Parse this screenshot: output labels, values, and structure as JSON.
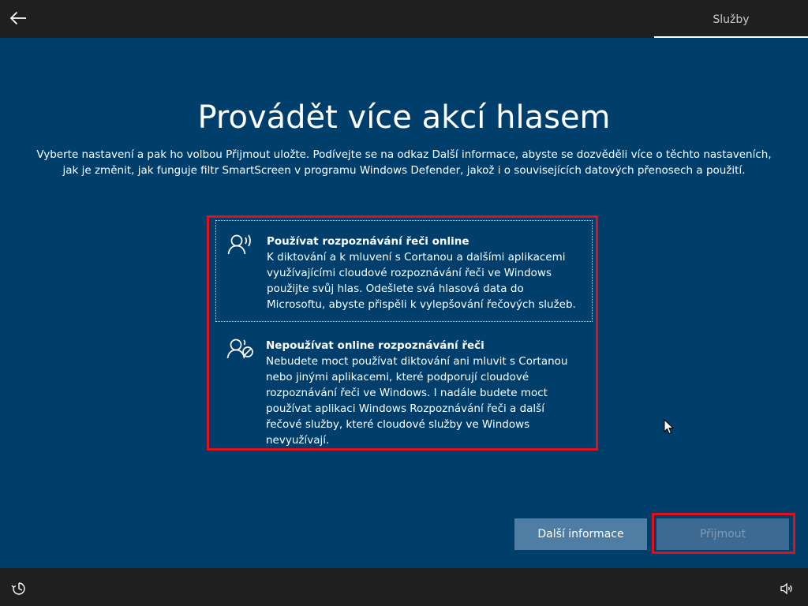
{
  "header": {
    "back_icon": "arrow-left-icon",
    "tab_label": "Služby"
  },
  "main": {
    "title": "Provádět více akcí hlasem",
    "subtitle": "Vyberte nastavení a pak ho volbou Přijmout uložte. Podívejte se na odkaz Další informace, abyste se dozvěděli více o těchto nastaveních, jak je změnit, jak funguje filtr SmartScreen v programu Windows Defender, jakož i o souvisejících datových přenosech a použití.",
    "options": [
      {
        "icon": "speech-person-icon",
        "title": "Používat rozpoznávání řeči online",
        "description": "K diktování a k mluvení s Cortanou a dalšími aplikacemi využívajícími cloudové rozpoznávání řeči ve Windows použijte svůj hlas. Odešlete svá hlasová data do Microsoftu, abyste přispěli k vylepšování řečových služeb."
      },
      {
        "icon": "speech-person-disabled-icon",
        "title": "Nepoužívat online rozpoznávání řeči",
        "description": "Nebudete moct používat diktování ani mluvit s Cortanou nebo jinými aplikacemi, které podporují cloudové rozpoznávání řeči ve Windows. I nadále budete moct používat aplikaci Windows Rozpoznávání řeči a další řečové služby, které cloudové služby ve Windows nevyužívají."
      }
    ]
  },
  "footer": {
    "more_info_label": "Další informace",
    "accept_label": "Přijmout",
    "ease_of_access_icon": "ease-of-access-icon",
    "volume_icon": "volume-icon"
  },
  "colors": {
    "background": "#003e6b",
    "bar": "#1f1f1f",
    "highlight": "#e0111a",
    "button": "#4f7da4"
  }
}
